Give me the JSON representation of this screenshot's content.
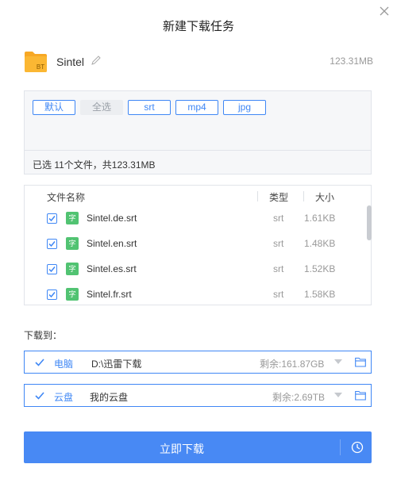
{
  "dialog": {
    "title": "新建下载任务"
  },
  "torrent": {
    "folder_badge": "BT",
    "name": "Sintel",
    "size": "123.31MB"
  },
  "filters": {
    "chips": [
      {
        "label": "默认",
        "active": true
      },
      {
        "label": "全选",
        "active": false
      },
      {
        "label": "srt",
        "active": true
      },
      {
        "label": "mp4",
        "active": true
      },
      {
        "label": "jpg",
        "active": true
      }
    ],
    "selection_summary": "已选 11个文件，共123.31MB"
  },
  "file_list": {
    "columns": {
      "name": "文件名称",
      "type": "类型",
      "size": "大小"
    },
    "rows": [
      {
        "icon_text": "字",
        "name": "Sintel.de.srt",
        "type": "srt",
        "size": "1.61KB",
        "checked": true
      },
      {
        "icon_text": "字",
        "name": "Sintel.en.srt",
        "type": "srt",
        "size": "1.48KB",
        "checked": true
      },
      {
        "icon_text": "字",
        "name": "Sintel.es.srt",
        "type": "srt",
        "size": "1.52KB",
        "checked": true
      },
      {
        "icon_text": "字",
        "name": "Sintel.fr.srt",
        "type": "srt",
        "size": "1.58KB",
        "checked": true
      }
    ]
  },
  "download_to": {
    "label": "下载到：",
    "destinations": [
      {
        "label": "电脑",
        "path": "D:\\迅雷下载",
        "free": "剩余:161.87GB",
        "checked": true
      },
      {
        "label": "云盘",
        "path": "我的云盘",
        "free": "剩余:2.69TB",
        "checked": true
      }
    ]
  },
  "actions": {
    "download_now": "立即下载"
  },
  "colors": {
    "accent": "#3f87f5",
    "button": "#4889f4",
    "folder": "#f7a825",
    "file_icon": "#51c372"
  }
}
